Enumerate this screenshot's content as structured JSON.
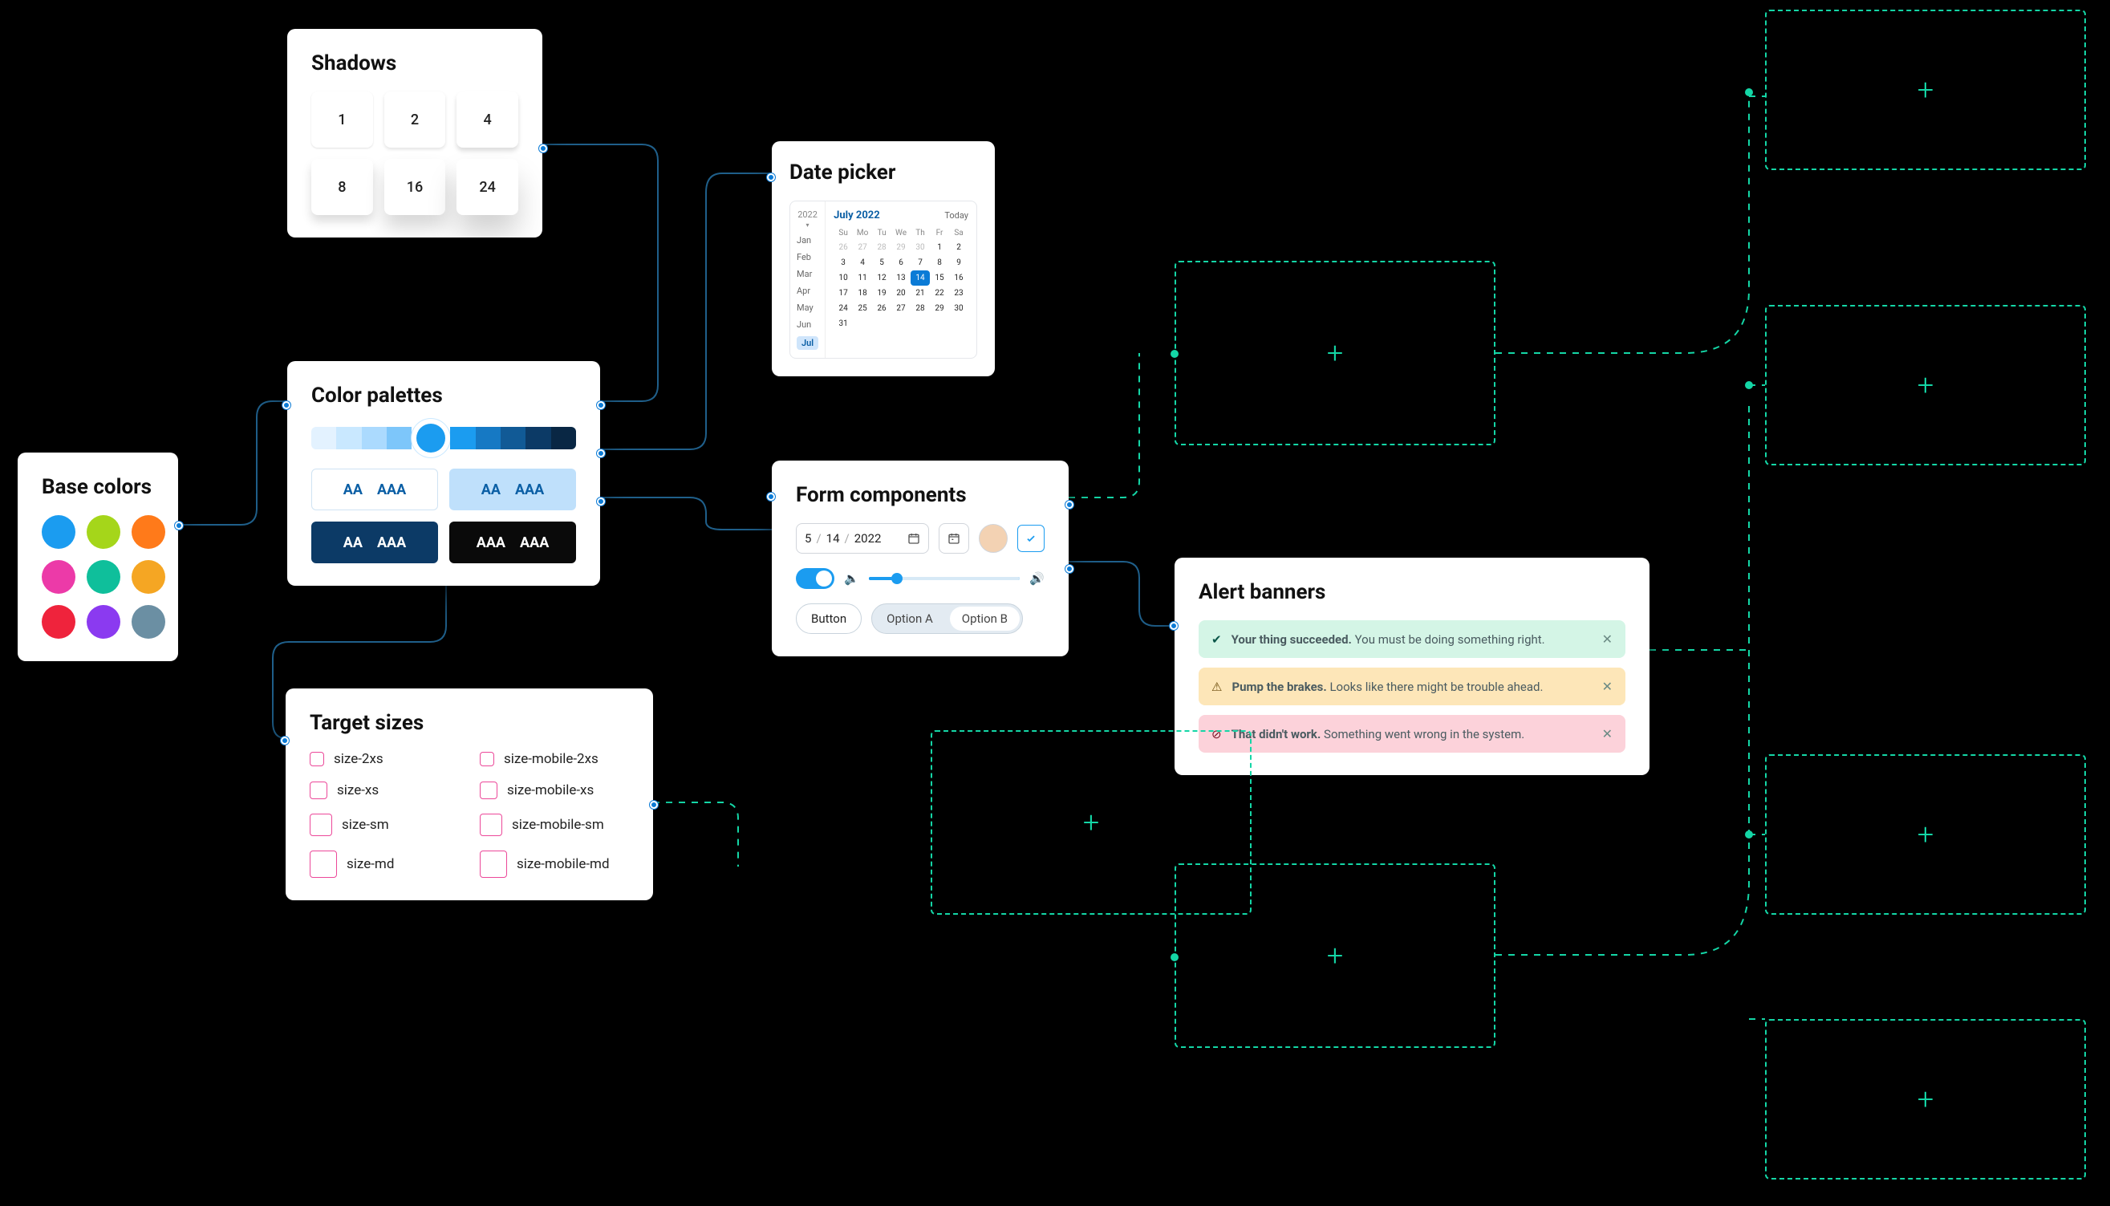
{
  "shadows": {
    "title": "Shadows",
    "values": [
      "1",
      "2",
      "4",
      "8",
      "16",
      "24"
    ]
  },
  "base_colors": {
    "title": "Base colors",
    "swatches": [
      "#1b9cf0",
      "#a5d61a",
      "#ff7a1a",
      "#ec3aa8",
      "#0fbf9b",
      "#f5a623",
      "#ef233c",
      "#8b3af0",
      "#6b8fa3"
    ]
  },
  "color_palettes": {
    "title": "Color palettes",
    "scale": [
      "#e3f2ff",
      "#c9e8ff",
      "#abdafe",
      "#7dc6fa",
      "#1b9cf0",
      "#1679c4",
      "#115a96",
      "#0c3a66",
      "#092744"
    ],
    "aa": "AA",
    "aaa": "AAA"
  },
  "target_sizes": {
    "title": "Target sizes",
    "items": [
      {
        "cls": "sz-2xs",
        "label": "size-2xs"
      },
      {
        "cls": "sz-2xs",
        "label": "size-mobile-2xs"
      },
      {
        "cls": "sz-xs",
        "label": "size-xs"
      },
      {
        "cls": "sz-xs",
        "label": "size-mobile-xs"
      },
      {
        "cls": "sz-sm",
        "label": "size-sm"
      },
      {
        "cls": "sz-sm",
        "label": "size-mobile-sm"
      },
      {
        "cls": "sz-md",
        "label": "size-md"
      },
      {
        "cls": "sz-md",
        "label": "size-mobile-md"
      }
    ]
  },
  "date_picker": {
    "title": "Date picker",
    "year": "2022",
    "month_title": "July 2022",
    "today": "Today",
    "months": [
      "Jan",
      "Feb",
      "Mar",
      "Apr",
      "May",
      "Jun",
      "Jul"
    ],
    "selected_month": "Jul",
    "dow": [
      "Su",
      "Mo",
      "Tu",
      "We",
      "Th",
      "Fr",
      "Sa"
    ],
    "weeks": [
      [
        {
          "n": "26",
          "mute": true
        },
        {
          "n": "27",
          "mute": true
        },
        {
          "n": "28",
          "mute": true
        },
        {
          "n": "29",
          "mute": true
        },
        {
          "n": "30",
          "mute": true
        },
        {
          "n": "1"
        },
        {
          "n": "2"
        }
      ],
      [
        {
          "n": "3"
        },
        {
          "n": "4"
        },
        {
          "n": "5"
        },
        {
          "n": "6"
        },
        {
          "n": "7"
        },
        {
          "n": "8"
        },
        {
          "n": "9"
        }
      ],
      [
        {
          "n": "10"
        },
        {
          "n": "11"
        },
        {
          "n": "12"
        },
        {
          "n": "13"
        },
        {
          "n": "14",
          "sel": true
        },
        {
          "n": "15"
        },
        {
          "n": "16"
        }
      ],
      [
        {
          "n": "17"
        },
        {
          "n": "18"
        },
        {
          "n": "19"
        },
        {
          "n": "20"
        },
        {
          "n": "21"
        },
        {
          "n": "22"
        },
        {
          "n": "23"
        }
      ],
      [
        {
          "n": "24"
        },
        {
          "n": "25"
        },
        {
          "n": "26"
        },
        {
          "n": "27"
        },
        {
          "n": "28"
        },
        {
          "n": "29"
        },
        {
          "n": "30"
        }
      ],
      [
        {
          "n": "31"
        },
        {
          "n": "",
          "mute": true
        },
        {
          "n": "",
          "mute": true
        },
        {
          "n": "",
          "mute": true
        },
        {
          "n": "",
          "mute": true
        },
        {
          "n": "",
          "mute": true
        },
        {
          "n": "",
          "mute": true
        }
      ]
    ]
  },
  "form": {
    "title": "Form components",
    "date": {
      "m": "5",
      "d": "14",
      "y": "2022"
    },
    "button": "Button",
    "optA": "Option A",
    "optB": "Option B"
  },
  "alerts": {
    "title": "Alert banners",
    "items": [
      {
        "type": "succ",
        "bold": "Your thing succeeded.",
        "msg": "You must be doing something right."
      },
      {
        "type": "warn",
        "bold": "Pump the brakes.",
        "msg": "Looks like there might be trouble ahead."
      },
      {
        "type": "err",
        "bold": "That didn't work.",
        "msg": "Something went wrong in the system."
      }
    ]
  }
}
